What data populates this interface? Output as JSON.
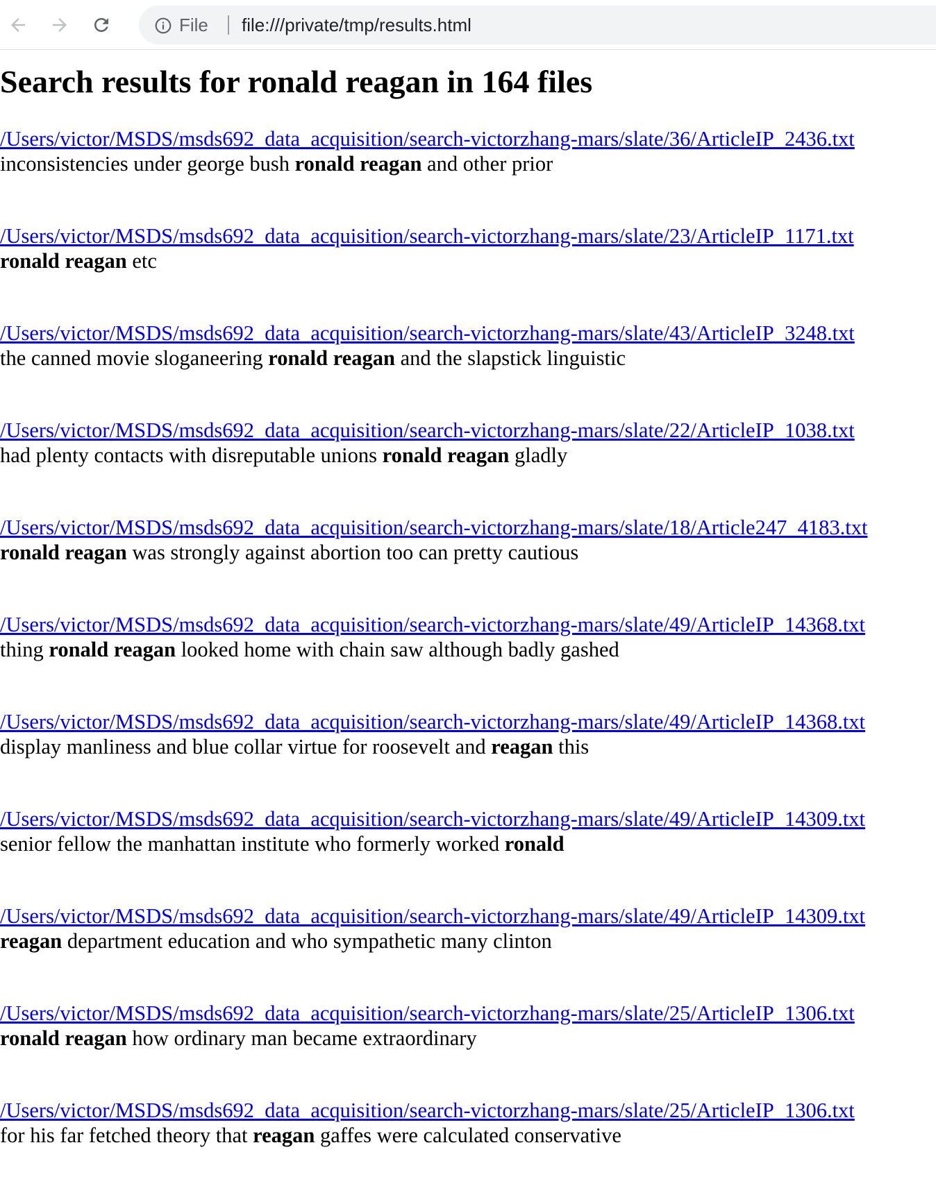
{
  "browser": {
    "back_icon": "arrow-left-icon",
    "forward_icon": "arrow-right-icon",
    "reload_icon": "reload-icon",
    "info_icon": "info-icon",
    "origin_chip": "File",
    "url": "file:///private/tmp/results.html",
    "colors": {
      "toolbar_bg": "#ffffff",
      "omnibox_bg": "#f1f3f4",
      "icon": "#5f6368",
      "url_text": "#202124"
    }
  },
  "page": {
    "title": "Search results for ronald reagan in 164 files",
    "link_color": "#0000ee",
    "results": [
      {
        "path": "/Users/victor/MSDS/msds692_data_acquisition/search-victorzhang-mars/slate/36/ArticleIP_2436.txt",
        "snippet": [
          {
            "text": "inconsistencies under george bush ",
            "bold": false
          },
          {
            "text": "ronald reagan",
            "bold": true
          },
          {
            "text": " and other prior",
            "bold": false
          }
        ]
      },
      {
        "path": "/Users/victor/MSDS/msds692_data_acquisition/search-victorzhang-mars/slate/23/ArticleIP_1171.txt",
        "snippet": [
          {
            "text": "ronald reagan",
            "bold": true
          },
          {
            "text": " etc",
            "bold": false
          }
        ]
      },
      {
        "path": "/Users/victor/MSDS/msds692_data_acquisition/search-victorzhang-mars/slate/43/ArticleIP_3248.txt",
        "snippet": [
          {
            "text": "the canned movie sloganeering ",
            "bold": false
          },
          {
            "text": "ronald reagan",
            "bold": true
          },
          {
            "text": " and the slapstick linguistic",
            "bold": false
          }
        ]
      },
      {
        "path": "/Users/victor/MSDS/msds692_data_acquisition/search-victorzhang-mars/slate/22/ArticleIP_1038.txt",
        "snippet": [
          {
            "text": "had plenty contacts with disreputable unions ",
            "bold": false
          },
          {
            "text": "ronald reagan",
            "bold": true
          },
          {
            "text": " gladly",
            "bold": false
          }
        ]
      },
      {
        "path": "/Users/victor/MSDS/msds692_data_acquisition/search-victorzhang-mars/slate/18/Article247_4183.txt",
        "snippet": [
          {
            "text": "ronald reagan",
            "bold": true
          },
          {
            "text": " was strongly against abortion too can pretty cautious",
            "bold": false
          }
        ]
      },
      {
        "path": "/Users/victor/MSDS/msds692_data_acquisition/search-victorzhang-mars/slate/49/ArticleIP_14368.txt",
        "snippet": [
          {
            "text": "thing ",
            "bold": false
          },
          {
            "text": "ronald reagan",
            "bold": true
          },
          {
            "text": " looked home with chain saw although badly gashed",
            "bold": false
          }
        ]
      },
      {
        "path": "/Users/victor/MSDS/msds692_data_acquisition/search-victorzhang-mars/slate/49/ArticleIP_14368.txt",
        "snippet": [
          {
            "text": "display manliness and blue collar virtue for roosevelt and ",
            "bold": false
          },
          {
            "text": "reagan",
            "bold": true
          },
          {
            "text": " this",
            "bold": false
          }
        ]
      },
      {
        "path": "/Users/victor/MSDS/msds692_data_acquisition/search-victorzhang-mars/slate/49/ArticleIP_14309.txt",
        "snippet": [
          {
            "text": "senior fellow the manhattan institute who formerly worked ",
            "bold": false
          },
          {
            "text": "ronald",
            "bold": true
          }
        ]
      },
      {
        "path": "/Users/victor/MSDS/msds692_data_acquisition/search-victorzhang-mars/slate/49/ArticleIP_14309.txt",
        "snippet": [
          {
            "text": "reagan",
            "bold": true
          },
          {
            "text": " department education and who sympathetic many clinton",
            "bold": false
          }
        ]
      },
      {
        "path": "/Users/victor/MSDS/msds692_data_acquisition/search-victorzhang-mars/slate/25/ArticleIP_1306.txt",
        "snippet": [
          {
            "text": "ronald reagan",
            "bold": true
          },
          {
            "text": " how ordinary man became extraordinary",
            "bold": false
          }
        ]
      },
      {
        "path": "/Users/victor/MSDS/msds692_data_acquisition/search-victorzhang-mars/slate/25/ArticleIP_1306.txt",
        "snippet": [
          {
            "text": "for his far fetched theory that ",
            "bold": false
          },
          {
            "text": "reagan",
            "bold": true
          },
          {
            "text": " gaffes were calculated conservative",
            "bold": false
          }
        ]
      }
    ]
  }
}
